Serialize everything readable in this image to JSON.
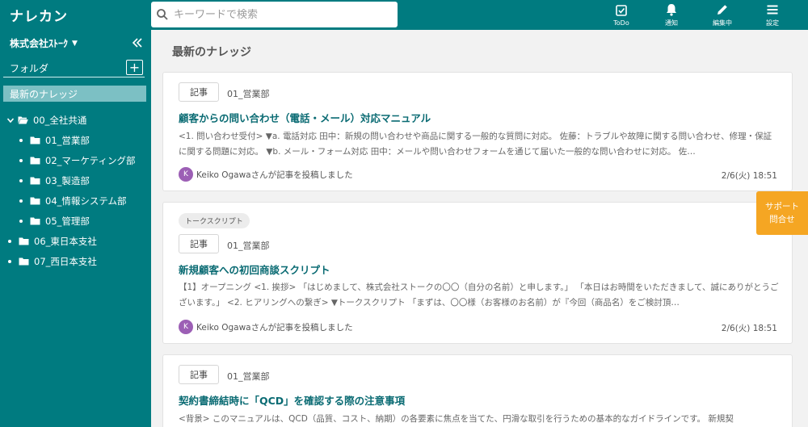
{
  "header": {
    "logo": "ナレカン",
    "search_placeholder": "キーワードで検索",
    "buttons": [
      {
        "label": "ToDo",
        "icon": "todo-checkbox-icon"
      },
      {
        "label": "通知",
        "icon": "bell-icon"
      },
      {
        "label": "編集中",
        "icon": "pencil-icon"
      },
      {
        "label": "設定",
        "icon": "menu-icon"
      }
    ]
  },
  "sidebar": {
    "company": "株式会社ｽﾄｰｸ",
    "folder_label": "フォルダ",
    "add_label": "+",
    "latest_label": "最新のナレッジ",
    "tree": [
      {
        "label": "00_全社共通",
        "level": 0,
        "expanded": true
      },
      {
        "label": "01_営業部",
        "level": 1
      },
      {
        "label": "02_マーケティング部",
        "level": 1
      },
      {
        "label": "03_製造部",
        "level": 1
      },
      {
        "label": "04_情報システム部",
        "level": 1
      },
      {
        "label": "05_管理部",
        "level": 1
      },
      {
        "label": "06_東日本支社",
        "level": 0
      },
      {
        "label": "07_西日本支社",
        "level": 0
      }
    ]
  },
  "main": {
    "title": "最新のナレッジ",
    "cards": [
      {
        "tag": "",
        "type": "記事",
        "dept": "01_営業部",
        "title": "顧客からの問い合わせ（電話・メール）対応マニュアル",
        "excerpt": "<1. 問い合わせ受付> ▼a. 電話対応 田中：新規の問い合わせや商品に関する一般的な質問に対応。 佐藤：トラブルや故障に関する問い合わせ、修理・保証に関する問題に対応。 ▼b. メール・フォーム対応 田中：メールや問い合わせフォームを通じて届いた一般的な問い合わせに対応。 佐…",
        "avatar": "K",
        "author": "Keiko Ogawaさんが記事を投稿しました",
        "date": "2/6(火) 18:51"
      },
      {
        "tag": "トークスクリプト",
        "type": "記事",
        "dept": "01_営業部",
        "title": "新規顧客への初回商談スクリプト",
        "excerpt": "【1】オープニング <1. 挨拶> 「はじめまして、株式会社ストークの〇〇（自分の名前）と申します。」 「本日はお時間をいただきまして、誠にありがとうございます。」 <2. ヒアリングへの繋ぎ> ▼トークスクリプト 「まずは、〇〇様（お客様のお名前）が『今回（商品名）をご検討頂…",
        "avatar": "K",
        "author": "Keiko Ogawaさんが記事を投稿しました",
        "date": "2/6(火) 18:51"
      },
      {
        "tag": "",
        "type": "記事",
        "dept": "01_営業部",
        "title": "契約書締結時に「QCD」を確認する際の注意事項",
        "excerpt": "<背景> このマニュアルは、QCD（品質、コスト、納期）の各要素に焦点を当てた、円滑な取引を行うための基本的なガイドラインです。 新規契",
        "avatar": "",
        "author": "",
        "date": ""
      }
    ]
  },
  "support": {
    "line1": "サポート",
    "line2": "問合せ"
  }
}
